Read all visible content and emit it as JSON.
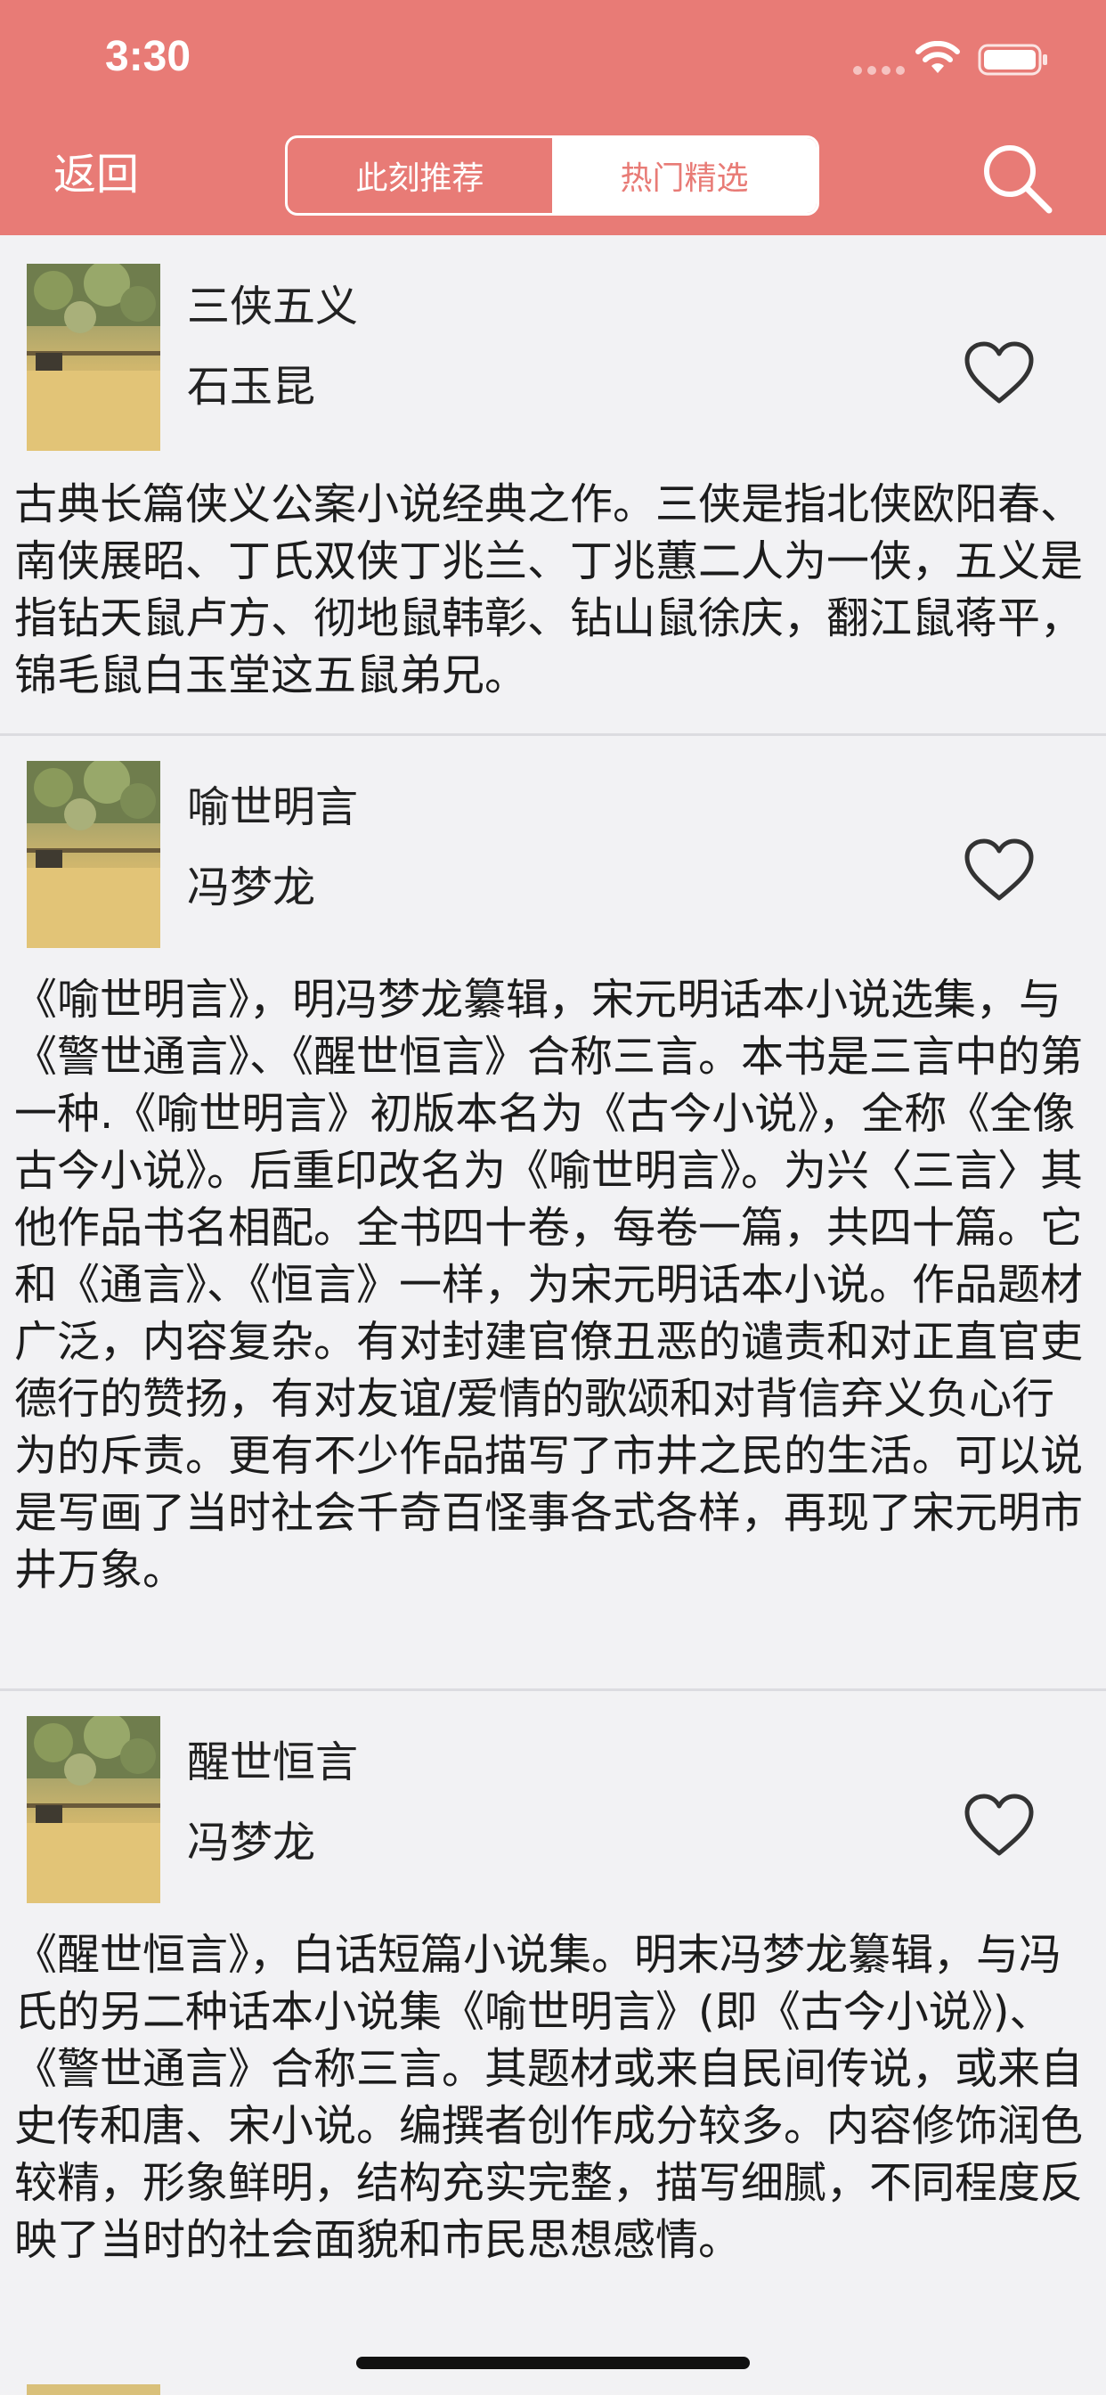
{
  "status_bar": {
    "time": "3:30"
  },
  "nav": {
    "back_label": "返回",
    "tabs": [
      {
        "label": "此刻推荐",
        "selected": false
      },
      {
        "label": "热门精选",
        "selected": true
      }
    ],
    "search_icon": "search-icon"
  },
  "colors": {
    "header": "#e87b76",
    "background": "#f2f2f4",
    "selected_tab_text": "#e87b76"
  },
  "books": [
    {
      "title": "三侠五义",
      "author": "石玉昆",
      "favorite_icon": "heart-outline-icon",
      "description": "古典长篇侠义公案小说经典之作。三侠是指北侠欧阳春、南侠展昭、丁氏双侠丁兆兰、丁兆蕙二人为一侠，五义是指钻天鼠卢方、彻地鼠韩彰、钻山鼠徐庆，翻江鼠蒋平，锦毛鼠白玉堂这五鼠弟兄。"
    },
    {
      "title": "喻世明言",
      "author": "冯梦龙",
      "favorite_icon": "heart-outline-icon",
      "description": "《喻世明言》，明冯梦龙纂辑，宋元明话本小说选集，与《警世通言》、《醒世恒言》合称三言。本书是三言中的第一种.《喻世明言》初版本名为《古今小说》，全称《全像古今小说》。后重印改名为《喻世明言》。为兴〈三言〉其他作品书名相配。全书四十卷，每卷一篇，共四十篇。它和《通言》、《恒言》一样，为宋元明话本小说。作品题材广泛，内容复杂。有对封建官僚丑恶的谴责和对正直官吏德行的赞扬，有对友谊/爱情的歌颂和对背信弃义负心行为的斥责。更有不少作品描写了市井之民的生活。可以说是写画了当时社会千奇百怪事各式各样，再现了宋元明市井万象。"
    },
    {
      "title": "醒世恒言",
      "author": "冯梦龙",
      "favorite_icon": "heart-outline-icon",
      "description": "《醒世恒言》，白话短篇小说集。明末冯梦龙纂辑，与冯氏的另二种话本小说集《喻世明言》(即《古今小说》)、《警世通言》合称三言。其题材或来自民间传说，或来自史传和唐、宋小说。编撰者创作成分较多。内容修饰润色较精，形象鲜明，结构充实完整，描写细腻，不同程度反映了当时的社会面貌和市民思想感情。"
    }
  ]
}
